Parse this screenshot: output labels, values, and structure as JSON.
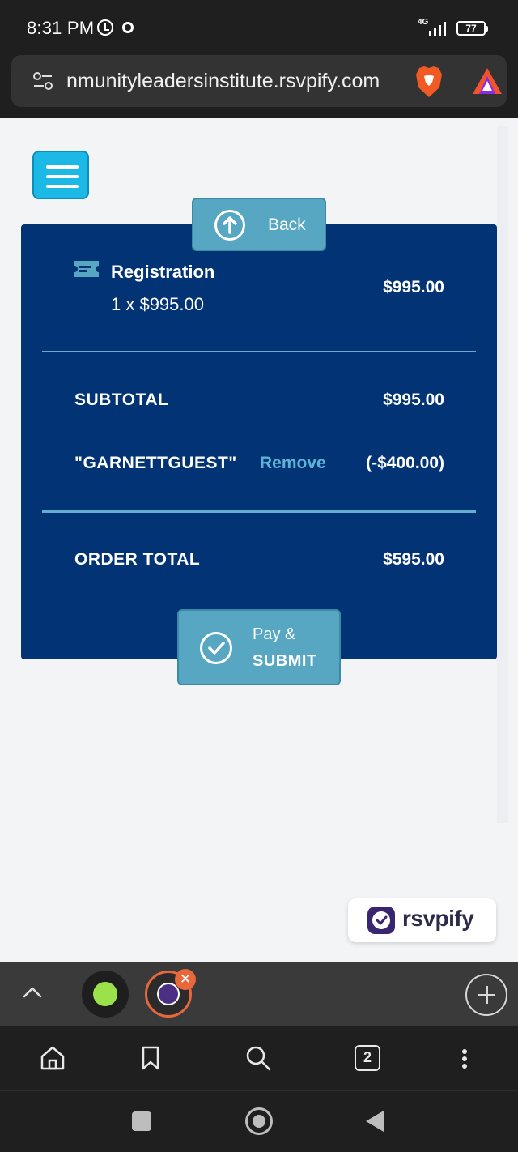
{
  "status_bar": {
    "time": "8:31 PM",
    "network": "4G",
    "battery": "77"
  },
  "browser": {
    "url": "nmunityleadersinstitute.rsvpify.com",
    "tabs_count": "2"
  },
  "order": {
    "back_label": "Back",
    "item_name": "Registration",
    "item_qty": "1 x $995.00",
    "item_price": "$995.00",
    "subtotal_label": "SUBTOTAL",
    "subtotal_value": "$995.00",
    "promo_code": "\"GARNETTGUEST\"",
    "remove_label": "Remove",
    "discount_value": "(-$400.00)",
    "total_label": "ORDER TOTAL",
    "total_value": "$595.00",
    "pay_line1": "Pay &",
    "pay_line2": "SUBMIT"
  },
  "branding": {
    "rsvpify_label": "rsvpify"
  },
  "colors": {
    "card_bg": "#023374",
    "button_bg": "#58a7c2",
    "menu_bg": "#1cb8e6",
    "link": "#5db2d6",
    "active_tab_ring": "#e8683c"
  }
}
